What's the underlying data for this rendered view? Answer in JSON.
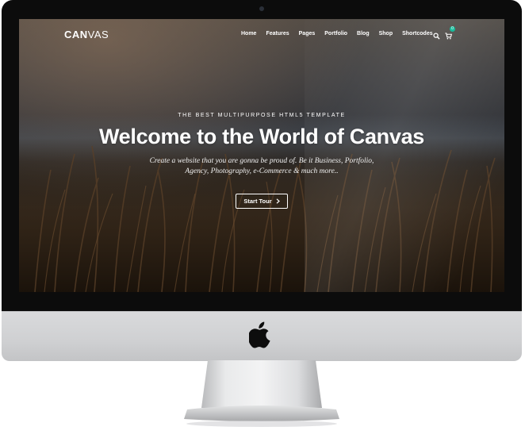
{
  "site": {
    "logo_bold": "CAN",
    "logo_thin": "VAS",
    "nav": [
      "Home",
      "Features",
      "Pages",
      "Portfolio",
      "Blog",
      "Shop",
      "Shortcodes"
    ],
    "cart_count": "0",
    "icons": {
      "search": "search-icon",
      "cart": "cart-icon"
    }
  },
  "hero": {
    "eyebrow": "THE BEST MULTIPURPOSE HTML5 TEMPLATE",
    "title": "Welcome to the World of Canvas",
    "subtitle_line1": "Create a website that you are gonna be proud of. Be it Business, Portfolio,",
    "subtitle_line2": "Agency, Photography, e-Commerce & much more..",
    "button_label": "Start Tour",
    "button_icon": "chevron-right-icon"
  },
  "colors": {
    "accent": "#1abc9c",
    "bezel": "#0c0c0c",
    "chin": "#d4d5d7"
  }
}
